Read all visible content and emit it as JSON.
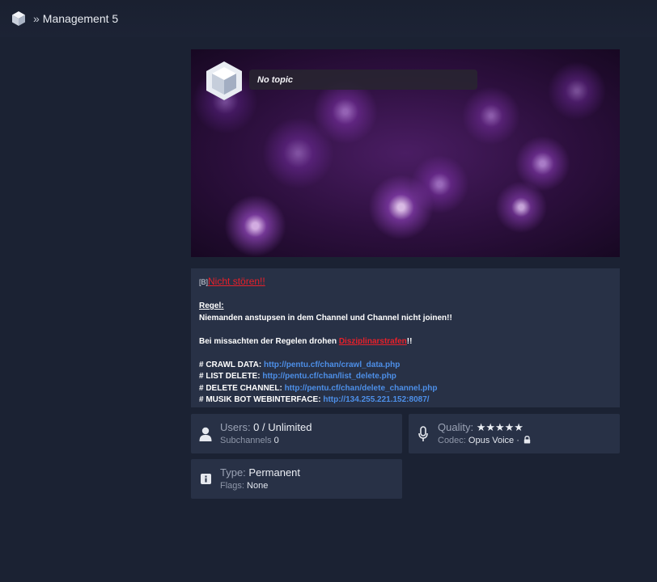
{
  "header": {
    "separator": "»",
    "channel_name": "Management 5"
  },
  "banner": {
    "topic": "No topic"
  },
  "description": {
    "tag": "[B]",
    "title": "Nicht stören!!",
    "rule_heading": "Regel:",
    "rule_text": "Niemanden anstupsen in dem Channel und Channel nicht joinen!!",
    "warning_prefix": "Bei missachten der Regelen drohen ",
    "warning_link": "Disziplinarstrafen",
    "warning_suffix": "!!",
    "links": [
      {
        "label": "# CRAWL DATA: ",
        "url": "http://pentu.cf/chan/crawl_data.php"
      },
      {
        "label": "# LIST DELETE: ",
        "url": "http://pentu.cf/chan/list_delete.php"
      },
      {
        "label": "# DELETE CHANNEL: ",
        "url": "http://pentu.cf/chan/delete_channel.php"
      },
      {
        "label": "# MUSIK BOT WEBINTERFACE: ",
        "url": "http://134.255.221.152:8087/"
      }
    ]
  },
  "users_card": {
    "icon": "user-icon",
    "users_label": "Users: ",
    "users_value": "0 / Unlimited",
    "subchannels_label": "Subchannels ",
    "subchannels_value": "0"
  },
  "quality_card": {
    "icon": "microphone-icon",
    "quality_label": "Quality: ",
    "quality_value": "★★★★★",
    "codec_label": "Codec: ",
    "codec_value": "Opus Voice ·",
    "lock_icon": "lock-icon"
  },
  "type_card": {
    "icon": "info-icon",
    "type_label": "Type: ",
    "type_value": "Permanent",
    "flags_label": "Flags: ",
    "flags_value": "None"
  }
}
